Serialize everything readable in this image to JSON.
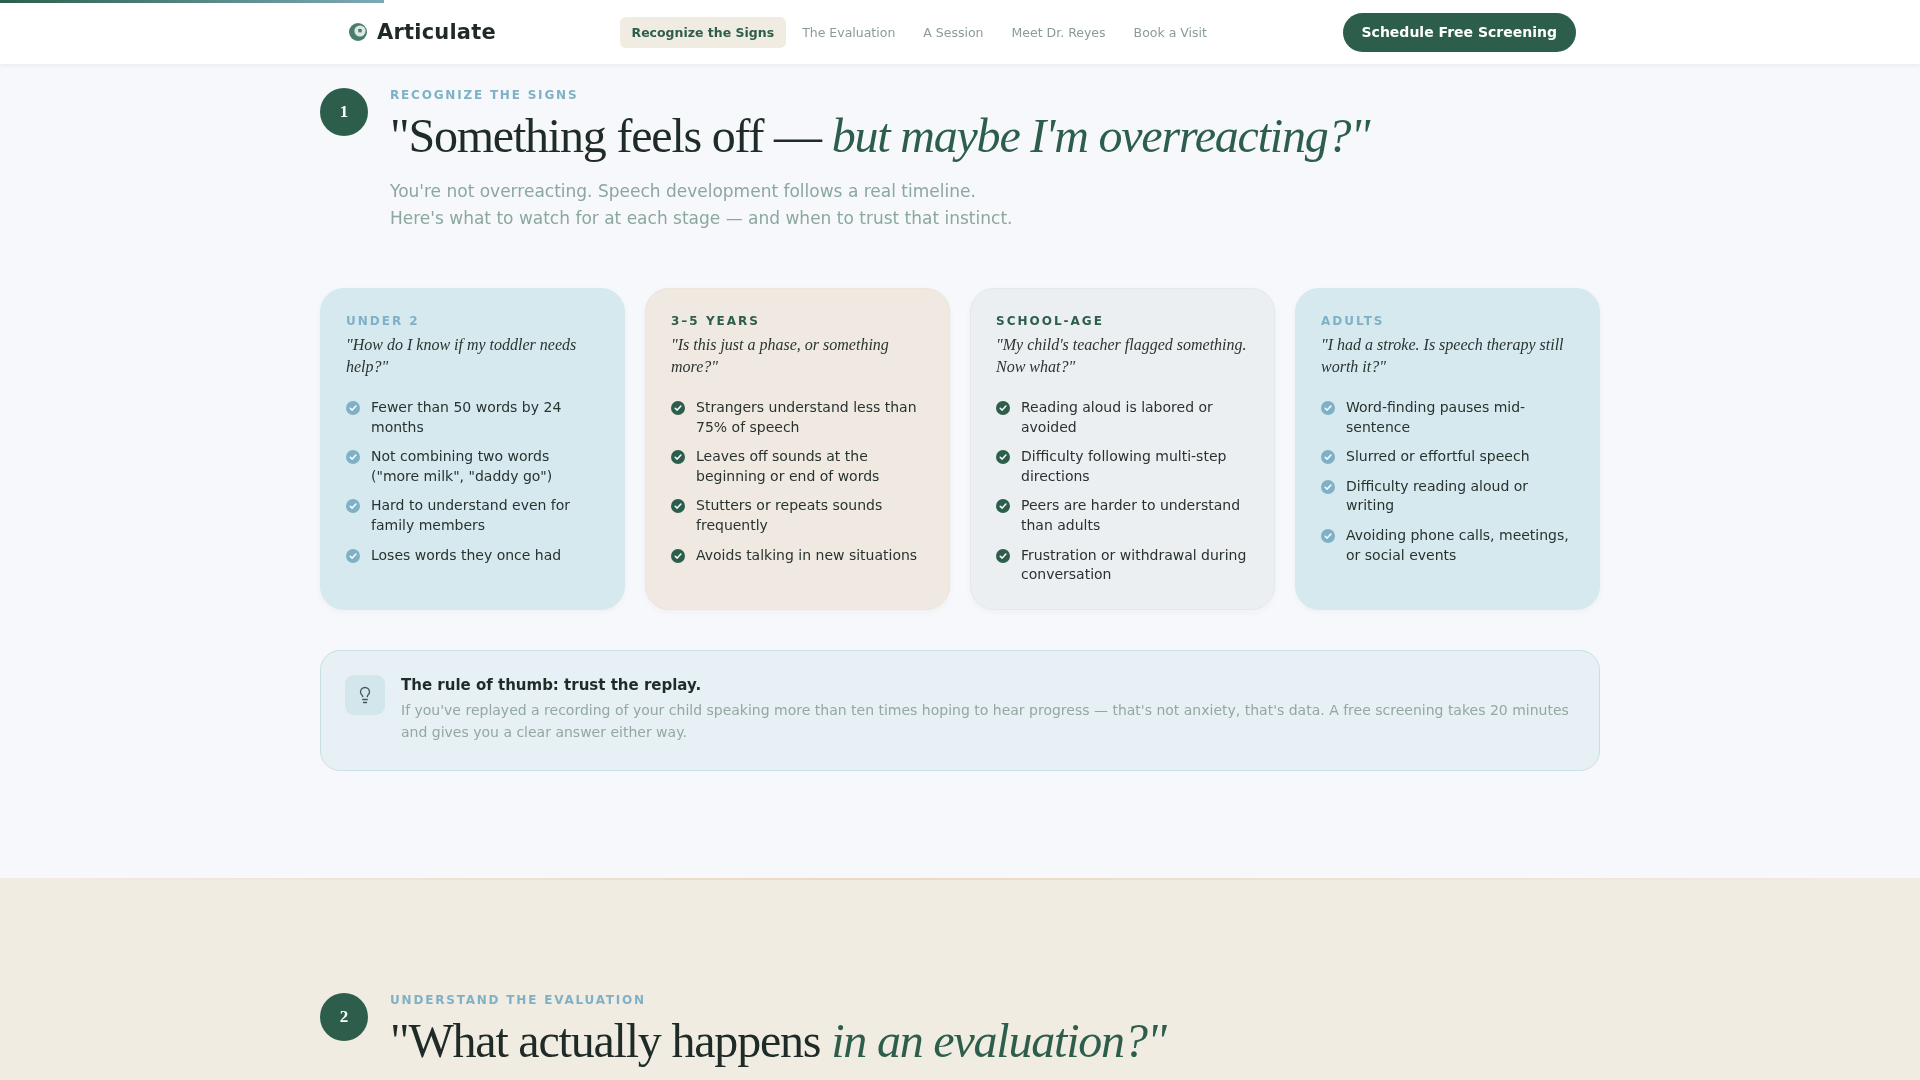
{
  "reading_progress": {
    "level": 0.2
  },
  "header": {
    "brand": "Articulate",
    "nav": [
      {
        "label": "Recognize the Signs",
        "selected": true
      },
      {
        "label": "The Evaluation",
        "selected": false
      },
      {
        "label": "A Session",
        "selected": false
      },
      {
        "label": "Meet Dr. Reyes",
        "selected": false
      },
      {
        "label": "Book a Visit",
        "selected": false
      }
    ],
    "cta": "Schedule Free Screening"
  },
  "sections": [
    {
      "kind": "plain",
      "step": "1",
      "kicker": "RECOGNIZE THE SIGNS",
      "heading": "\"Something feels off — *but maybe I'm overreacting?\"*",
      "intro": [
        "You're not overreacting. Speech development follows a real timeline.",
        "Here's what to watch for at each stage — and when to trust that instinct."
      ],
      "cards": [
        {
          "kind": "cool",
          "color": "#7fb1c6",
          "label": "UNDER 2",
          "quote": "\"How do I know if my toddler needs help?\"",
          "signs": [
            "Fewer than 50 words by 24 months",
            "Not combining two words (\"more milk\", \"daddy go\")",
            "Hard to understand even for family members",
            "Loses words they once had"
          ]
        },
        {
          "kind": "warm",
          "color": "#2d5e4c",
          "label": "3–5 YEARS",
          "quote": "\"Is this just a phase, or something more?\"",
          "signs": [
            "Strangers understand less than 75% of speech",
            "Leaves off sounds at the beginning or end of words",
            "Stutters or repeats sounds frequently",
            "Avoids talking in new situations"
          ]
        },
        {
          "kind": "neutral",
          "color": "#2d5e4c",
          "label": "SCHOOL-AGE",
          "quote": "\"My child's teacher flagged something. Now what?\"",
          "signs": [
            "Reading aloud is labored or avoided",
            "Difficulty following multi-step directions",
            "Peers are harder to understand than adults",
            "Frustration or withdrawal during conversation"
          ]
        },
        {
          "kind": "cool",
          "color": "#7fb1c6",
          "label": "ADULTS",
          "quote": "\"I had a stroke. Is speech therapy still worth it?\"",
          "signs": [
            "Word-finding pauses mid-sentence",
            "Slurred or effortful speech",
            "Difficulty reading aloud or writing",
            "Avoiding phone calls, meetings, or social events"
          ]
        }
      ],
      "tip": {
        "title": "The rule of thumb: trust the replay.",
        "text": "If you've replayed a recording of your child speaking more than ten times hoping to hear progress — that's not anxiety, that's data. A free screening takes 20 minutes and gives you a clear answer either way."
      }
    },
    {
      "kind": "sand",
      "step": "2",
      "kicker": "UNDERSTAND THE EVALUATION",
      "heading": "\"What actually happens *in an evaluation?\"*"
    }
  ]
}
